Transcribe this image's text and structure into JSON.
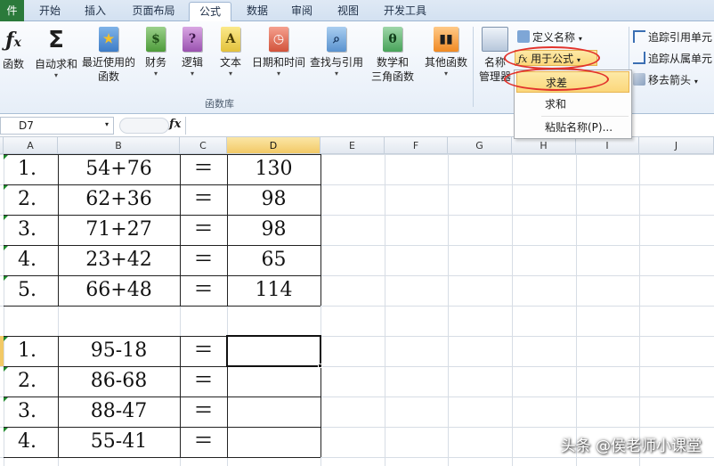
{
  "tabs": [
    {
      "label": "件",
      "active": false
    },
    {
      "label": "开始",
      "active": false
    },
    {
      "label": "插入",
      "active": false
    },
    {
      "label": "页面布局",
      "active": false
    },
    {
      "label": "公式",
      "active": true
    },
    {
      "label": "数据",
      "active": false
    },
    {
      "label": "审阅",
      "active": false
    },
    {
      "label": "视图",
      "active": false
    },
    {
      "label": "开发工具",
      "active": false
    }
  ],
  "ribbon": {
    "func_lib": {
      "insert_fn": "函数",
      "autosum": "自动求和",
      "recent_1": "最近使用的",
      "recent_2": "函数",
      "finance": "财务",
      "logic": "逻辑",
      "text": "文本",
      "datetime": "日期和时间",
      "lookup": "查找与引用",
      "math_1": "数学和",
      "math_2": "三角函数",
      "other": "其他函数",
      "group_label": "函数库"
    },
    "names": {
      "manager_1": "名称",
      "manager_2": "管理器",
      "define_name": "定义名称",
      "use_in_formula": "用于公式"
    },
    "audit": {
      "trace_precedents": "追踪引用单元",
      "trace_dependents": "追踪从属单元",
      "remove_arrows": "移去箭头"
    }
  },
  "dropdown": {
    "items": [
      "求差",
      "求和",
      "粘贴名称(P)..."
    ]
  },
  "formula_bar": {
    "name_box": "D7",
    "fx": "fx"
  },
  "grid": {
    "columns": [
      "A",
      "B",
      "C",
      "D",
      "E",
      "F",
      "G",
      "H",
      "I",
      "J"
    ],
    "selected_column": "D",
    "selected_cell": "D7",
    "table1": [
      {
        "no": "1.",
        "expr": "54+76",
        "eq": "＝",
        "result": "130"
      },
      {
        "no": "2.",
        "expr": "62+36",
        "eq": "＝",
        "result": "98"
      },
      {
        "no": "3.",
        "expr": "71+27",
        "eq": "＝",
        "result": "98"
      },
      {
        "no": "4.",
        "expr": "23+42",
        "eq": "＝",
        "result": "65"
      },
      {
        "no": "5.",
        "expr": "66+48",
        "eq": "＝",
        "result": "114"
      }
    ],
    "table2": [
      {
        "no": "1.",
        "expr": "95-18",
        "eq": "＝",
        "result": ""
      },
      {
        "no": "2.",
        "expr": "86-68",
        "eq": "＝",
        "result": ""
      },
      {
        "no": "3.",
        "expr": "88-47",
        "eq": "＝",
        "result": ""
      },
      {
        "no": "4.",
        "expr": "55-41",
        "eq": "＝",
        "result": ""
      }
    ]
  },
  "watermark": "头条 @侯老师小课堂",
  "colors": {
    "file_tab": "#2b7a3b",
    "highlight": "#fbd77b",
    "annotation": "#e2332c",
    "selected_header": "#f2c966"
  }
}
